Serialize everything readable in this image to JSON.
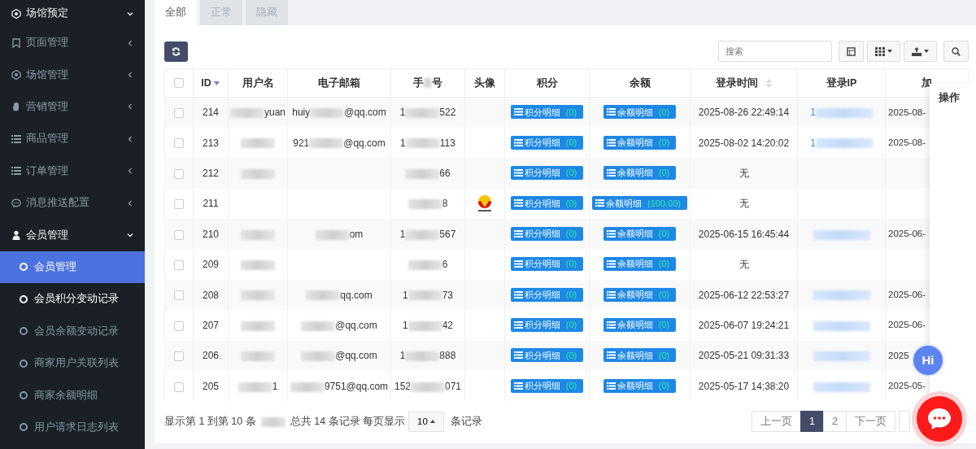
{
  "sidebar": {
    "header": {
      "label": "场馆预定",
      "expanded": true
    },
    "items": [
      {
        "label": "页面管理",
        "expanded": false
      },
      {
        "label": "场馆管理",
        "expanded": false
      },
      {
        "label": "营销管理",
        "expanded": false
      },
      {
        "label": "商品管理",
        "expanded": false
      },
      {
        "label": "订单管理",
        "expanded": false
      },
      {
        "label": "消息推送配置",
        "expanded": false
      },
      {
        "label": "会员管理",
        "expanded": true,
        "children": [
          {
            "label": "会员管理",
            "selected": true,
            "hovered": false
          },
          {
            "label": "会员积分变动记录",
            "selected": false,
            "hovered": true
          },
          {
            "label": "会员余额变动记录",
            "selected": false,
            "hovered": false
          },
          {
            "label": "商家用户关联列表",
            "selected": false,
            "hovered": false
          },
          {
            "label": "商家余额明细",
            "selected": false,
            "hovered": false
          },
          {
            "label": "用户请求日志列表",
            "selected": false,
            "hovered": false
          }
        ]
      }
    ]
  },
  "tabs": [
    {
      "label": "全部",
      "selected": true
    },
    {
      "label": "正常",
      "selected": false
    },
    {
      "label": "隐藏",
      "selected": false
    }
  ],
  "search": {
    "placeholder": "搜索"
  },
  "table": {
    "select_all": {
      "checked": false
    },
    "columns": [
      {
        "lead": "ID",
        "sorted": true
      },
      {
        "lead": "用户名"
      },
      {
        "lead": "电子邮箱"
      },
      {
        "lead": "手",
        "tail": "号",
        "redacted": true
      },
      {
        "lead": "头像"
      },
      {
        "lead": "积分"
      },
      {
        "lead": "余额"
      },
      {
        "lead": "登录时间",
        "sortable": true
      },
      {
        "lead": "登录IP"
      },
      {
        "lead": "加"
      },
      {
        "lead": "操作"
      }
    ],
    "rows": [
      {
        "checked": false,
        "id": "214",
        "user": {
          "tail": "yuan",
          "redacted": true
        },
        "email": {
          "lead": "huiy",
          "tail": "@qq.com",
          "redacted": true
        },
        "phone": {
          "lead": "1",
          "tail": "522",
          "redacted": true
        },
        "score": {
          "label": "积分明细",
          "count": "(0)"
        },
        "balance": {
          "label": "余额明细",
          "count": "(0)"
        },
        "login_time": "2025-08-26 22:49:14",
        "ip": {
          "lead": "1",
          "redacted": true
        },
        "joined": "2025-08-"
      },
      {
        "checked": false,
        "id": "213",
        "user": {
          "redacted": true
        },
        "email": {
          "lead": "921",
          "tail": "@qq.com",
          "redacted": true
        },
        "phone": {
          "lead": "1",
          "tail": "113",
          "redacted": true
        },
        "score": {
          "label": "积分明细",
          "count": "(0)"
        },
        "balance": {
          "label": "余额明细",
          "count": "(0)"
        },
        "login_time": "2025-08-02 14:20:02",
        "ip": {
          "lead": "1",
          "redacted": true
        },
        "joined": "2025-08-"
      },
      {
        "checked": false,
        "id": "212",
        "user": {
          "redacted": true
        },
        "phone": {
          "tail": "66",
          "redacted": true
        },
        "score": {
          "label": "积分明细",
          "count": "(0)"
        },
        "balance": {
          "label": "余额明细",
          "count": "(0)"
        },
        "login_time": "无"
      },
      {
        "checked": false,
        "id": "211",
        "phone": {
          "tail": "8",
          "redacted": true
        },
        "avatar": true,
        "score": {
          "label": "积分明细",
          "count": "(0)"
        },
        "balance": {
          "label": "余额明细",
          "count": "(100.00)"
        },
        "login_time": "无"
      },
      {
        "checked": false,
        "id": "210",
        "user": {
          "redacted": true
        },
        "email": {
          "tail": "om",
          "redacted": true
        },
        "phone": {
          "lead": "1",
          "tail": "567",
          "redacted": true
        },
        "score": {
          "label": "积分明细",
          "count": "(0)"
        },
        "balance": {
          "label": "余额明细",
          "count": "(0)"
        },
        "login_time": "2025-06-15 16:45:44",
        "ip": {
          "redacted": true
        },
        "joined": "2025-06-"
      },
      {
        "checked": false,
        "id": "209",
        "user": {
          "redacted": true
        },
        "phone": {
          "tail": "6",
          "redacted": true
        },
        "score": {
          "label": "积分明细",
          "count": "(0)"
        },
        "balance": {
          "label": "余额明细",
          "count": "(0)"
        },
        "login_time": "无"
      },
      {
        "checked": false,
        "id": "208",
        "user": {
          "redacted": true
        },
        "email": {
          "tail": "qq.com",
          "redacted": true
        },
        "phone": {
          "lead": "1",
          "tail": "73",
          "redacted": true
        },
        "score": {
          "label": "积分明细",
          "count": "(0)"
        },
        "balance": {
          "label": "余额明细",
          "count": "(0)"
        },
        "login_time": "2025-06-12 22:53:27",
        "ip": {
          "redacted": true
        },
        "joined": "2025-06-"
      },
      {
        "checked": false,
        "id": "207",
        "user": {
          "redacted": true
        },
        "email": {
          "tail": "@qq.com",
          "redacted": true
        },
        "phone": {
          "lead": "1",
          "tail": "42",
          "redacted": true
        },
        "score": {
          "label": "积分明细",
          "count": "(0)"
        },
        "balance": {
          "label": "余额明细",
          "count": "(0)"
        },
        "login_time": "2025-06-07 19:24:21",
        "ip": {
          "redacted": true
        },
        "joined": "2025-06-"
      },
      {
        "checked": false,
        "id": "206",
        "user": {
          "redacted": true
        },
        "email": {
          "tail": "@qq.com",
          "redacted": true
        },
        "phone": {
          "lead": "1",
          "tail": "888",
          "redacted": true
        },
        "score": {
          "label": "积分明细",
          "count": "(0)"
        },
        "balance": {
          "label": "余额明细",
          "count": "(0)"
        },
        "login_time": "2025-05-21 09:31:33",
        "ip": {
          "redacted": true
        },
        "joined": "2025"
      },
      {
        "checked": false,
        "id": "205",
        "user": {
          "tail": "1",
          "redacted": true
        },
        "email": {
          "tail": "9751@qq.com",
          "redacted": true
        },
        "phone": {
          "lead": "152",
          "tail": "071",
          "redacted": true
        },
        "score": {
          "label": "积分明细",
          "count": "(0)"
        },
        "balance": {
          "label": "余额明细",
          "count": "(0)"
        },
        "login_time": "2025-05-17 14:38:20",
        "ip": {
          "redacted": true
        },
        "joined": "2025-05-"
      }
    ]
  },
  "footer": {
    "summary_lead": "显示第 1 到第 10 条",
    "summary_tail": "总共 14 条记录 每页显示",
    "page_size": "10",
    "page_size_suffix": "条记录",
    "redacted": true
  },
  "pagination": [
    {
      "label": "上一页",
      "selected": false
    },
    {
      "label": "1",
      "selected": true
    },
    {
      "label": "2",
      "selected": false
    },
    {
      "label": "下一页",
      "selected": false
    }
  ],
  "hi_bubble": {
    "label": "Hi"
  }
}
